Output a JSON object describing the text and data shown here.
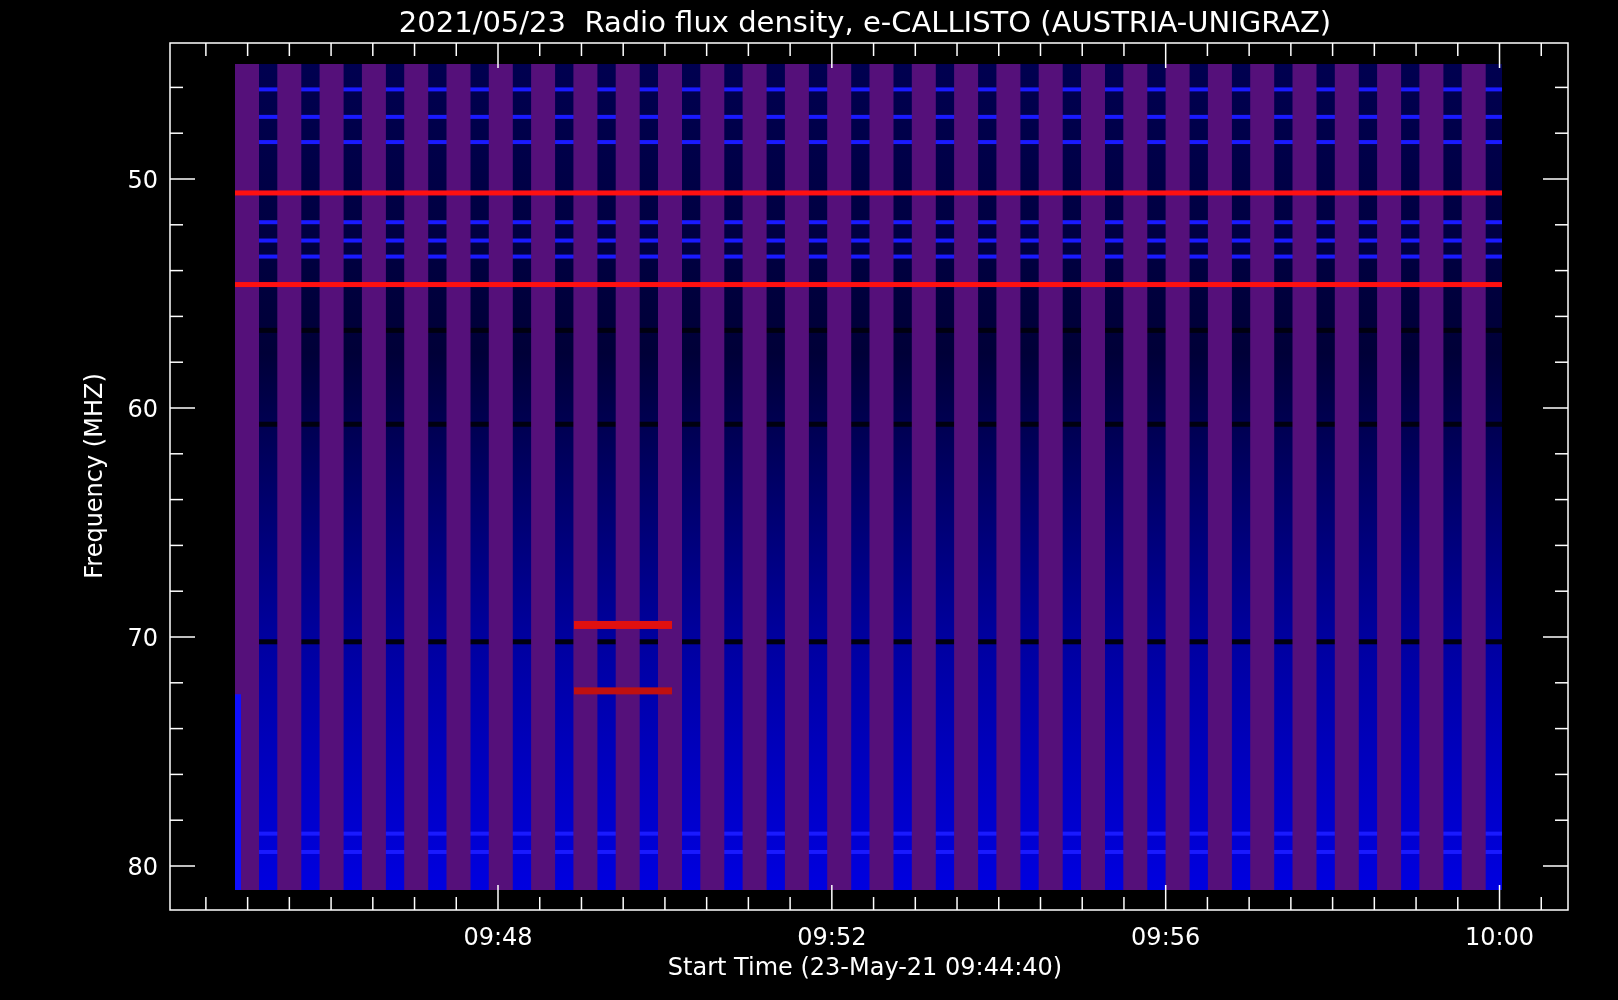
{
  "title": "2021/05/23  Radio flux density, e-CALLISTO (AUSTRIA-UNIGRAZ)",
  "y_axis": {
    "label": "Frequency (MHZ)",
    "ticks": [
      "50",
      "60",
      "70",
      "80"
    ]
  },
  "x_axis": {
    "label": "Start Time (23-May-21 09:44:40)",
    "ticks": [
      "09:48",
      "09:52",
      "09:56",
      "10:00"
    ]
  }
}
